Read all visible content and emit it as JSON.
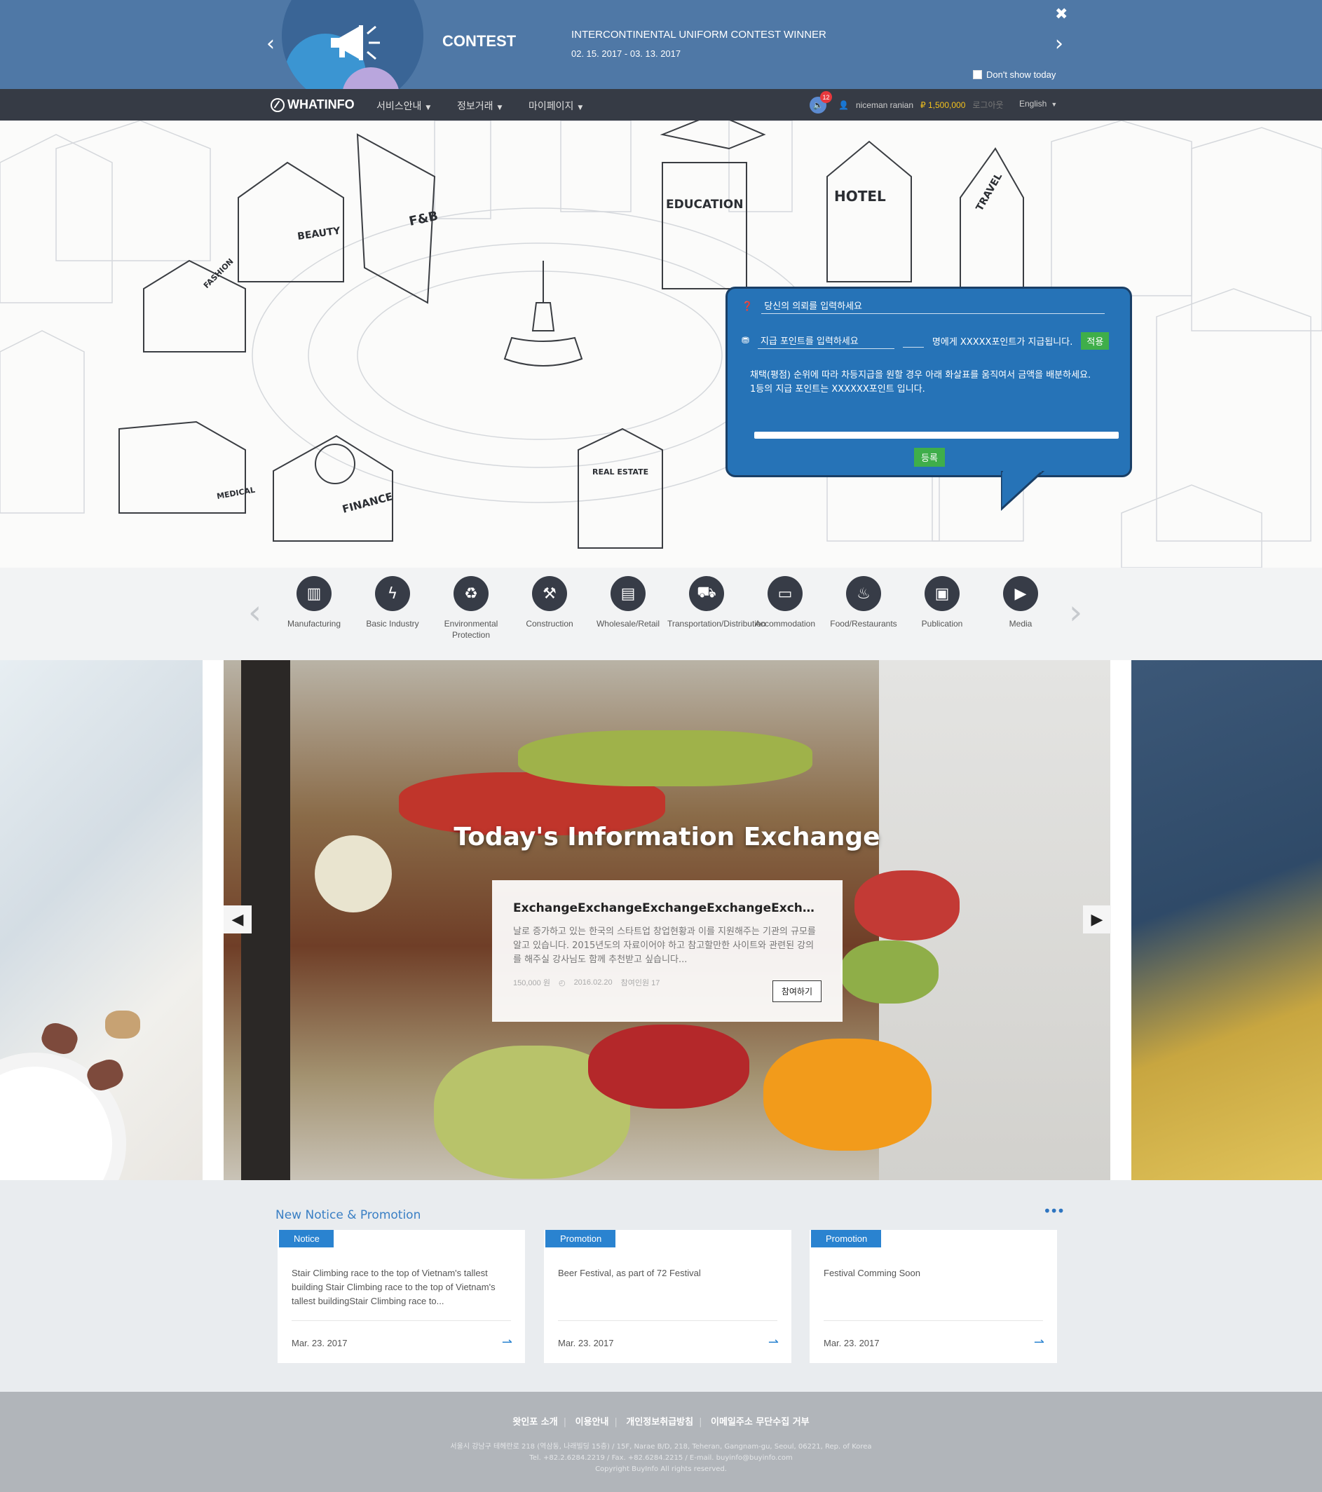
{
  "banner": {
    "title": "CONTEST",
    "headline": "INTERCONTINENTAL UNIFORM CONTEST WINNER",
    "dates": "02. 15. 2017 - 03. 13. 2017",
    "dont_show": "Don't show today",
    "icons": {
      "prev": "chevron-left-icon",
      "next": "chevron-right-icon",
      "close": "close-icon",
      "megaphone": "megaphone-icon"
    }
  },
  "nav": {
    "logo": "WHATINFO",
    "menu": [
      "서비스안내",
      "정보거래",
      "마이페이지"
    ],
    "notification_count": "12",
    "username": "niceman ranian",
    "points": "1,500,000",
    "logout": "로그아웃",
    "language": "English"
  },
  "hero": {
    "street_labels": [
      "BEAUTY",
      "F&B",
      "EDUCATION",
      "HOTEL",
      "TRAVEL",
      "FASHION",
      "MEDICAL",
      "FINANCE",
      "REAL ESTATE"
    ],
    "bubble": {
      "request_placeholder": "당신의 의뢰를 입력하세요",
      "points_placeholder": "지급 포인트를 입력하세요",
      "points_suffix": "명에게 XXXXX포인트가 지급됩니다.",
      "apply": "적용",
      "desc_1": "채택(평점) 순위에 따라 차등지급을 원할 경우 아래 화살표를 움직여서 금액을 배분하세요.",
      "desc_2": "1등의 지급 포인트는 XXXXXX포인트 입니다.",
      "submit": "등록"
    }
  },
  "categories": [
    {
      "label": "Manufacturing",
      "icon": "factory-icon",
      "glyph": "▥"
    },
    {
      "label": "Basic Industry",
      "icon": "energy-icon",
      "glyph": "ϟ"
    },
    {
      "label": "Environmental Protection",
      "icon": "recycle-icon",
      "glyph": "♻"
    },
    {
      "label": "Construction",
      "icon": "construction-icon",
      "glyph": "⚒"
    },
    {
      "label": "Wholesale/Retail",
      "icon": "store-icon",
      "glyph": "▤"
    },
    {
      "label": "Transportation/Distribution",
      "icon": "truck-icon",
      "glyph": "⛟"
    },
    {
      "label": "Accommodation",
      "icon": "bed-icon",
      "glyph": "▭"
    },
    {
      "label": "Food/Restaurants",
      "icon": "food-icon",
      "glyph": "♨"
    },
    {
      "label": "Publication",
      "icon": "book-icon",
      "glyph": "▣"
    },
    {
      "label": "Media",
      "icon": "film-icon",
      "glyph": "▶"
    }
  ],
  "carousel": {
    "headline": "Today's Information Exchange",
    "card": {
      "title": "ExchangeExchangeExchangeExchangeExchangeE...",
      "body": "날로 증가하고 있는 한국의 스타트업 창업현황과 이를 지원해주는 기관의 규모를 알고 있습니다. 2015년도의 자료이어야 하고 참고할만한 사이트와 관련된 강의를 해주실 강사님도 함께 추천받고 싶습니다...",
      "price": "150,000 원",
      "date": "2016.02.20",
      "participants": "참여인원 17",
      "join": "참여하기"
    }
  },
  "notices": {
    "heading": "New Notice & Promotion",
    "more": "•••",
    "items": [
      {
        "tag": "Notice",
        "text": "Stair Climbing race to the top of Vietnam's tallest building Stair Climbing race to the top of Vietnam's tallest buildingStair Climbing race to...",
        "date": "Mar. 23. 2017"
      },
      {
        "tag": "Promotion",
        "text": "Beer Festival, as part of 72 Festival",
        "date": "Mar. 23. 2017"
      },
      {
        "tag": "Promotion",
        "text": "Festival Comming Soon",
        "date": "Mar. 23. 2017"
      }
    ]
  },
  "footer": {
    "links": [
      "왓인포 소개",
      "이용안내",
      "개인정보취급방침",
      "이메일주소 무단수집 거부"
    ],
    "address": "서울시 강남구 테헤란로 218 (역삼동, 나래빌딩 15층) / 15F, Narae B/D, 218, Teheran, Gangnam-gu, Seoul, 06221, Rep. of Korea",
    "contact": "Tel. +82.2.6284.2219 / Fax. +82.6284.2215 / E-mail. buyinfo@buyinfo.com",
    "copyright": "Copyright BuyInfo All rights reserved."
  },
  "colors": {
    "banner_bg": "#4f78a6",
    "nav_bg": "#363b45",
    "bubble_bg": "#2673b7",
    "accent_green": "#3fae4a",
    "accent_blue": "#2a83d0",
    "points_yellow": "#f4c21c"
  }
}
